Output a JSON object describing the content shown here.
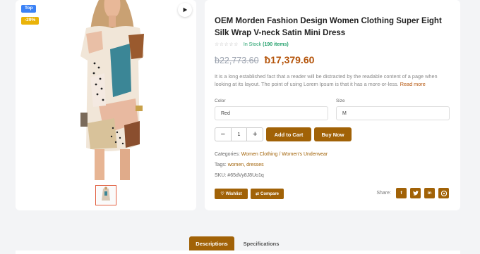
{
  "gallery": {
    "badge_top": "Top",
    "badge_sale": "-29%",
    "image_alt": "Woman in abstract-print satin mini dress",
    "thumb_count": 1
  },
  "product": {
    "title": "OEM Morden Fashion Design Women Clothing Super Eight Silk Wrap V-neck Satin Mini Dress",
    "stars": "☆☆☆☆☆",
    "stock_label": "In Stock",
    "stock_count": "(190 items)",
    "old_price": "ƀ22,773.60",
    "new_price": "ƀ17,379.60",
    "description": "It is a long established fact that a reader will be distracted by the readable content of a page when looking at its layout. The point of using Lorem Ipsum is that it has a more-or-less.",
    "read_more": "Read more"
  },
  "options": {
    "color_label": "Color",
    "color_value": "Red",
    "size_label": "Size",
    "size_value": "M"
  },
  "actions": {
    "qty_minus": "−",
    "qty_value": "1",
    "qty_plus": "+",
    "add_to_cart": "Add to Cart",
    "buy_now": "Buy Now",
    "wishlist": "Wishlist",
    "compare": "Compare"
  },
  "meta": {
    "categories_label": "Categories:",
    "categories_value": "Women Clothing / Women's Underwear",
    "tags_label": "Tags:",
    "tag_1": "women",
    "tag_2": "dresses",
    "sku_label": "SKU:",
    "sku_value": "#65dVy8J8Uo1q"
  },
  "share": {
    "label": "Share:",
    "icons": [
      "facebook-icon",
      "twitter-icon",
      "linkedin-icon",
      "pinterest-icon"
    ]
  },
  "tabs": {
    "descriptions": "Descriptions",
    "specifications": "Specifications"
  },
  "colors": {
    "accent": "#a16207",
    "price": "#b45309",
    "stock": "#22a06b",
    "badge_top": "#3b82f6",
    "badge_sale": "#eab308"
  }
}
